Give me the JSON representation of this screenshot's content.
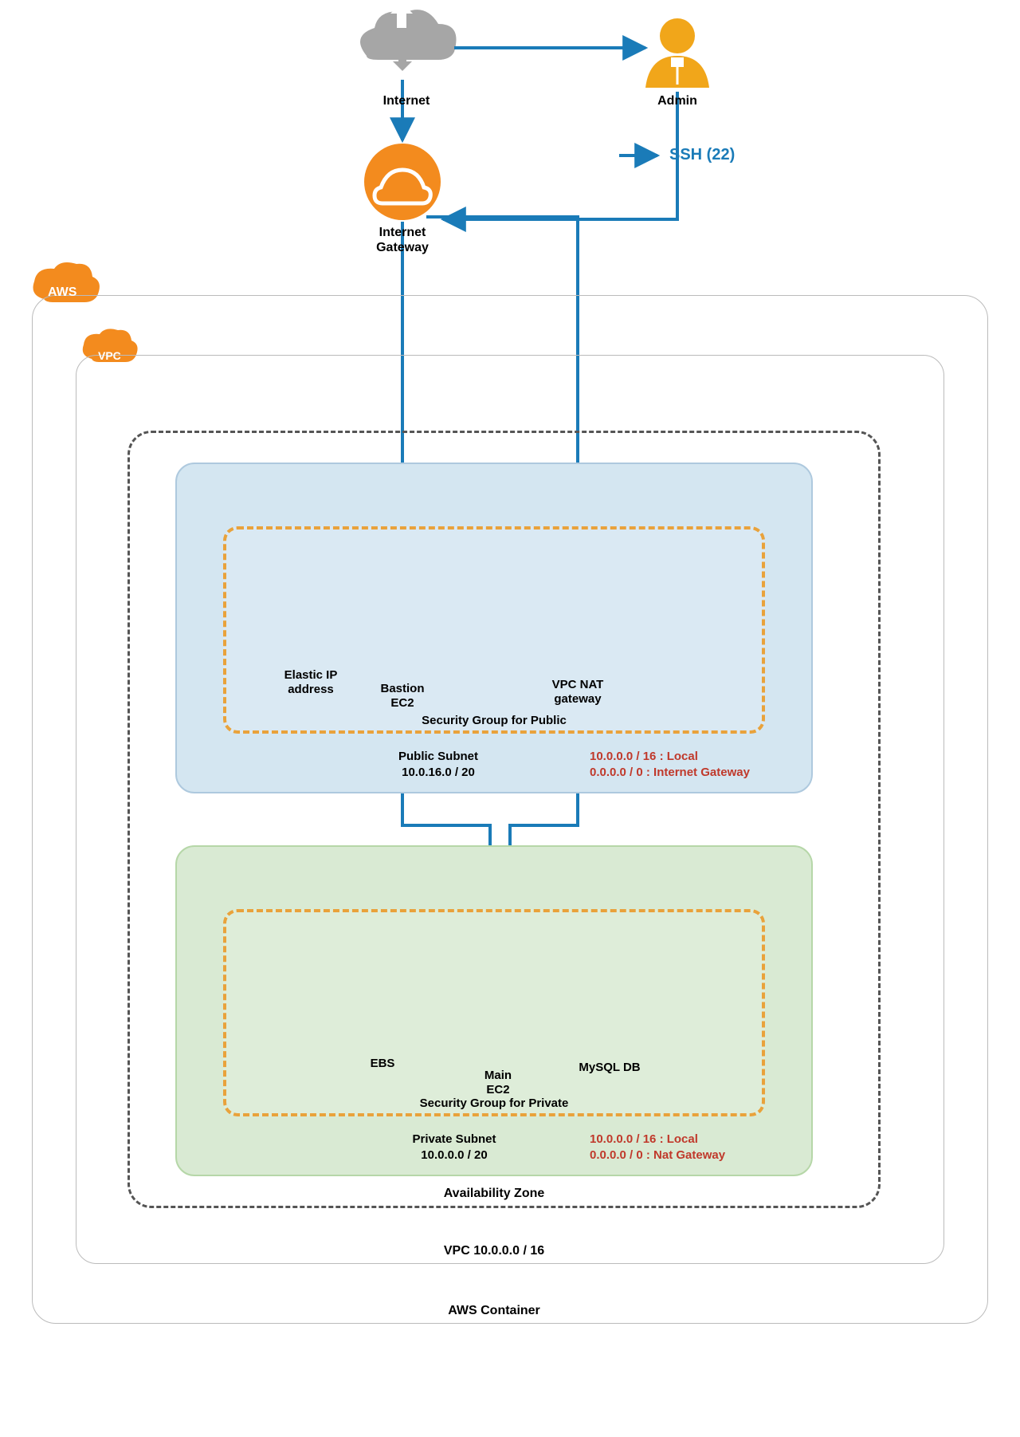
{
  "nodes": {
    "internet": "Internet",
    "admin": "Admin",
    "legend_ssh": "SSH (22)",
    "igw_line1": "Internet",
    "igw_line2": "Gateway",
    "elastic_ip_line1": "Elastic IP",
    "elastic_ip_line2": "address",
    "bastion_line1": "Bastion",
    "bastion_line2": "EC2",
    "nat_line1": "VPC NAT",
    "nat_line2": "gateway",
    "sg_public": "Security Group for Public",
    "public_subnet_line1": "Public Subnet",
    "public_subnet_line2": "10.0.16.0 / 20",
    "pub_route_line1": "10.0.0.0 / 16 : Local",
    "pub_route_line2": "0.0.0.0 / 0 : Internet Gateway",
    "ebs": "EBS",
    "main_line1": "Main",
    "main_line2": "EC2",
    "mysql": "MySQL DB",
    "sg_private": "Security Group for Private",
    "private_subnet_line1": "Private Subnet",
    "private_subnet_line2": "10.0.0.0 / 20",
    "priv_route_line1": "10.0.0.0 / 16 : Local",
    "priv_route_line2": "0.0.0.0 / 0 : Nat Gateway",
    "az": "Availability Zone",
    "vpc": "VPC  10.0.0.0 / 16",
    "aws_container": "AWS Container",
    "badge_aws": "AWS",
    "badge_vpc": "VPC"
  }
}
